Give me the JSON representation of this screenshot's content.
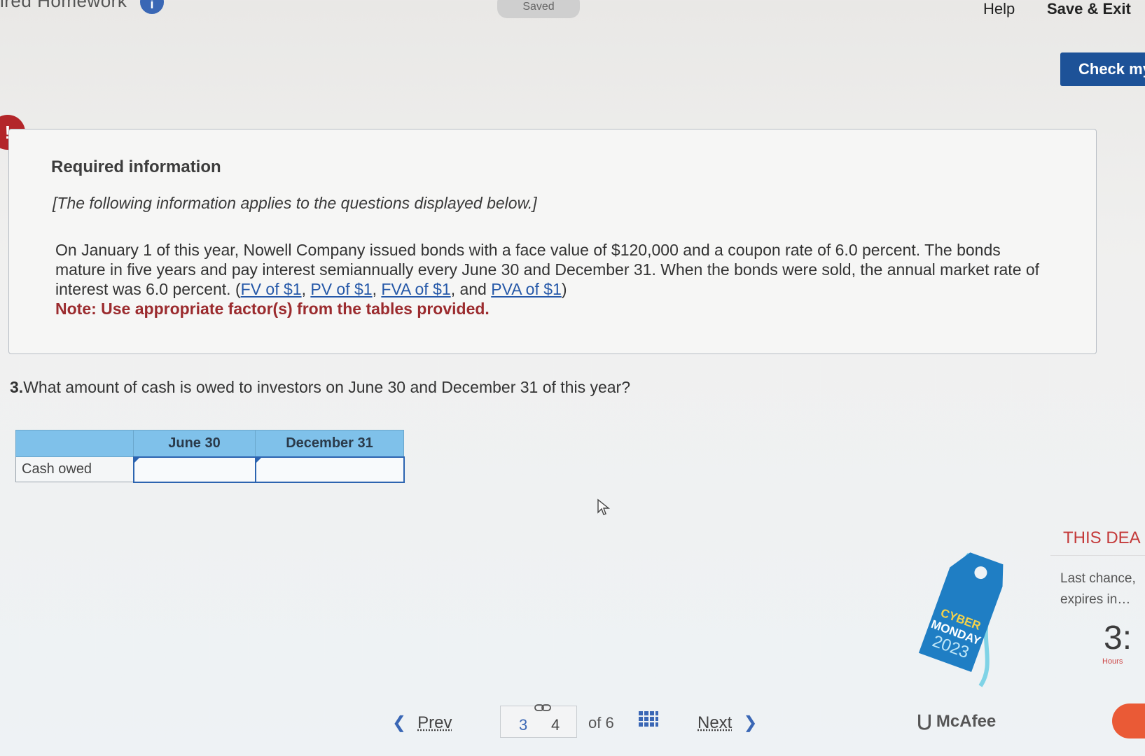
{
  "topbar": {
    "app_title": "ired Homework",
    "info_icon_label": "i",
    "saved_label": "Saved",
    "help_label": "Help",
    "save_exit_label": "Save & Exit",
    "check_label": "Check my"
  },
  "alert": {
    "icon": "!"
  },
  "info": {
    "title": "Required information",
    "subtitle": "[The following information applies to the questions displayed below.]",
    "body": "On January 1 of this year, Nowell Company issued bonds with a face value of $120,000 and a coupon rate of 6.0 percent. The bonds mature in five years and pay interest semiannually every June 30 and December 31. When the bonds were sold, the annual market rate of interest was 6.0 percent.",
    "links": [
      "FV of $1",
      "PV of $1",
      "FVA of $1",
      "PVA of $1"
    ],
    "and_word": "and",
    "note": "Note: Use appropriate factor(s) from the tables provided."
  },
  "question": {
    "number": "3.",
    "text": "What amount of cash is owed to investors on June 30 and December 31 of this year?"
  },
  "table": {
    "headers": [
      "",
      "June 30",
      "December 31"
    ],
    "row_label": "Cash owed",
    "values": [
      "",
      ""
    ]
  },
  "pagination": {
    "prev_label": "Prev",
    "current_page": "3",
    "next_page": "4",
    "of_label": "of 6",
    "next_label": "Next"
  },
  "promo": {
    "tag_line1": "CYBER",
    "tag_line2": "MONDAY",
    "tag_line3": "2023",
    "brand": "McAfee",
    "title": "THIS DEA",
    "text_line1": "Last chance,",
    "text_line2": "expires in…",
    "countdown": "3:",
    "hours_label": "Hours"
  },
  "colors": {
    "brand_blue": "#1d5298",
    "alert_red": "#b3262a",
    "header_blue": "#7fc1ea",
    "note_red": "#9b2b2e",
    "promo_orange": "#ea5a36"
  }
}
